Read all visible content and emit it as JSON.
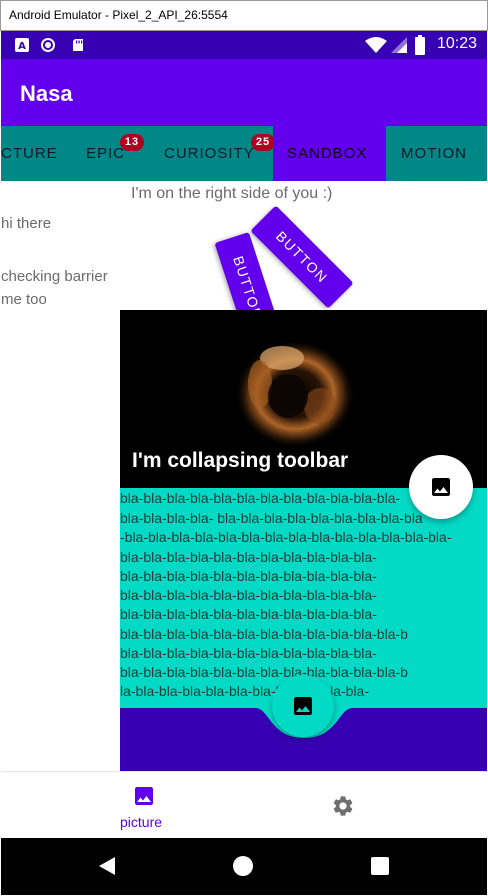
{
  "window": {
    "title": "Android Emulator - Pixel_2_API_26:5554"
  },
  "status_bar": {
    "time": "10:23",
    "icons": [
      "a-notification-icon",
      "record-icon",
      "sd-card-icon",
      "wifi-icon",
      "signal-icon",
      "battery-icon"
    ],
    "color": "#3700b3"
  },
  "app_bar": {
    "title": "Nasa",
    "color": "#6200ee"
  },
  "tabs": {
    "items": [
      {
        "label": "PICTURE",
        "visible_label": "CTURE"
      },
      {
        "label": "EPIC",
        "badge": "13"
      },
      {
        "label": "CURIOSITY",
        "badge": "25"
      },
      {
        "label": "SANDBOX",
        "active": true
      },
      {
        "label": "MOTION"
      }
    ],
    "background": "#018786",
    "active_color": "#6200ee",
    "badge_color": "#b00020"
  },
  "sandbox": {
    "right_side_text": "I'm on the right side of you :)",
    "greeting": "hi there",
    "barrier_text": "checking barrier",
    "me_too": "me too",
    "rotated_button_1": "BUTTON",
    "rotated_button_2": "BUTTON"
  },
  "collapsing": {
    "title": "I'm collapsing toolbar",
    "body_lines": [
      "bla-bla-bla-bla-bla-bla-bla-bla-bla-bla-bla-bla-",
      "bla-bla-bla-bla- bla-bla-bla-bla-bla-bla-bla-bla-bla",
      "-bla-bla-bla-bla-bla-bla-bla-bla-bla-bla-bla-bla-bla-bla-",
      "bla-bla-bla-bla-bla-bla-bla-bla-bla-bla-bla-",
      "bla-bla-bla-bla-bla-bla-bla-bla-bla-bla-bla-",
      "bla-bla-bla-bla-bla-bla-bla-bla-bla-bla-bla-",
      "bla-bla-bla-bla-bla-bla-bla-bla-bla-bla-bla-",
      "bla-bla-bla-bla-bla-bla-bla-bla-bla-bla-bla-bla-b",
      "bla-bla-bla-bla-bla-bla-bla-bla-bla-bla-bla-",
      "bla-bla-bla-bla-bla-bla-bla-bla-bla-bla-bla-bla-b",
      "la-bla-bla-bla-bla-bla-bla-bla-bla-bla-bla-"
    ],
    "body_color": "#03dac5",
    "bottom_color": "#3700b3"
  },
  "bottom_nav": {
    "items": [
      {
        "label": "picture",
        "icon": "image-icon",
        "active": true
      },
      {
        "label": "",
        "icon": "gear-icon"
      }
    ],
    "active_color": "#6200ee"
  },
  "system_nav": {
    "icons": [
      "back-icon",
      "home-icon",
      "recents-icon"
    ]
  }
}
